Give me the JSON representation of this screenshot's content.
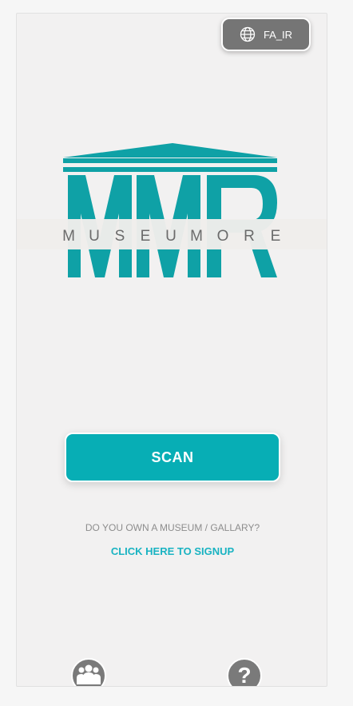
{
  "header": {
    "language_button_label": "FA_IR",
    "language_icon": "globe-icon"
  },
  "logo": {
    "brand_text": "MUSEUMORE",
    "letters": [
      "M",
      "U",
      "S",
      "E",
      "U",
      "M",
      "O",
      "R",
      "E"
    ],
    "color": "#0fa1a6"
  },
  "main": {
    "scan_label": "SCAN",
    "own_museum_text": "DO YOU OWN A MUSEUM / GALLARY?",
    "signup_link": "CLICK HERE TO SIGNUP"
  },
  "footer": {
    "left_icon": "team-icon",
    "right_icon": "help-icon",
    "help_glyph": "?"
  },
  "colors": {
    "accent": "#07aeb5",
    "link": "#19b3c2",
    "button_gray": "#757575"
  }
}
